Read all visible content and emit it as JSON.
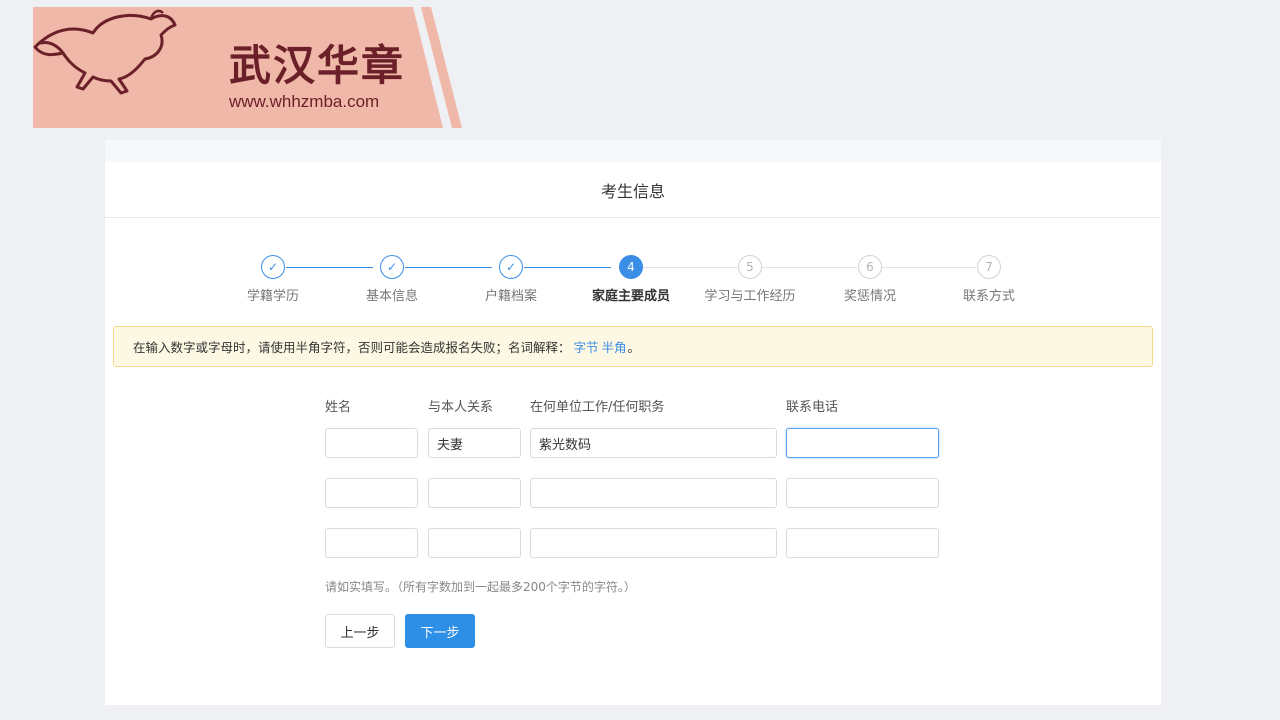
{
  "logo": {
    "name": "武汉华章",
    "url": "www.whhzmba.com"
  },
  "page": {
    "title": "考生信息"
  },
  "steps": [
    {
      "label": "学籍学历",
      "num": "1",
      "state": "done"
    },
    {
      "label": "基本信息",
      "num": "2",
      "state": "done"
    },
    {
      "label": "户籍档案",
      "num": "3",
      "state": "done"
    },
    {
      "label": "家庭主要成员",
      "num": "4",
      "state": "active"
    },
    {
      "label": "学习与工作经历",
      "num": "5",
      "state": "todo"
    },
    {
      "label": "奖惩情况",
      "num": "6",
      "state": "todo"
    },
    {
      "label": "联系方式",
      "num": "7",
      "state": "todo"
    }
  ],
  "notice": {
    "text": "在输入数字或字母时，请使用半角字符，否则可能会造成报名失败；名词解释：",
    "link1": "字节",
    "link2": "半角",
    "end": "。"
  },
  "form": {
    "headers": {
      "name": "姓名",
      "relation": "与本人关系",
      "work": "在何单位工作/任何职务",
      "phone": "联系电话"
    },
    "rows": [
      {
        "name": "",
        "relation": "夫妻",
        "work": "紫光数码",
        "phone": ""
      },
      {
        "name": "",
        "relation": "",
        "work": "",
        "phone": ""
      },
      {
        "name": "",
        "relation": "",
        "work": "",
        "phone": ""
      }
    ],
    "hint": "请如实填写。（所有字数加到一起最多200个字节的字符。）"
  },
  "buttons": {
    "prev": "上一步",
    "next": "下一步"
  },
  "colors": {
    "accent": "#3a8ee6",
    "banner": "#f0b8a8",
    "logo_text": "#6b1f28"
  }
}
